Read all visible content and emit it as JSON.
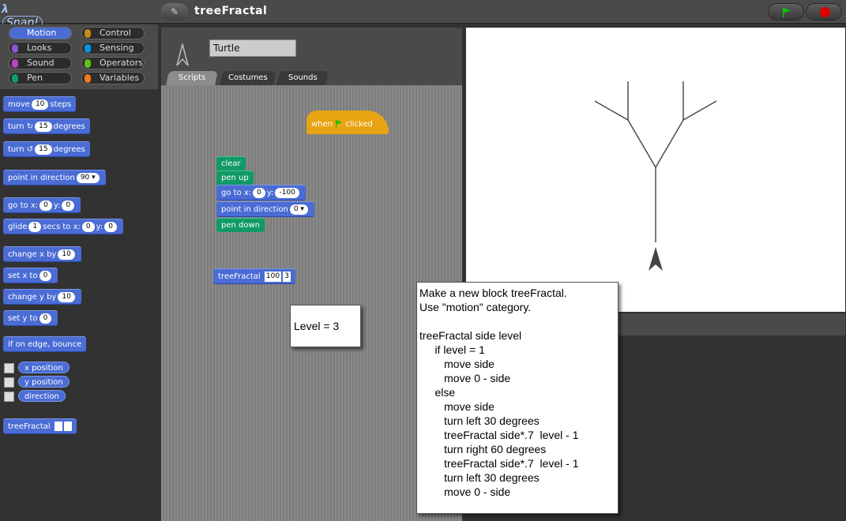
{
  "app": {
    "logo_lambda": "λ",
    "logo_text": "Snap!",
    "project_icon": "✎",
    "project_title": "treeFractal"
  },
  "colors": {
    "motion": "#4a6cd4",
    "control": "#e8a412",
    "pen": "#119a66",
    "stop": "#e00000",
    "go": "#00c000"
  },
  "categories": [
    {
      "label": "Motion",
      "color": "#4a6cd4",
      "selected": true
    },
    {
      "label": "Control",
      "color": "#c88a1a"
    },
    {
      "label": "Looks",
      "color": "#8a55d7"
    },
    {
      "label": "Sensing",
      "color": "#0494dc"
    },
    {
      "label": "Sound",
      "color": "#bb42c3"
    },
    {
      "label": "Operators",
      "color": "#62c213"
    },
    {
      "label": "Pen",
      "color": "#0e9a6c"
    },
    {
      "label": "Variables",
      "color": "#f3761d"
    }
  ],
  "palette": {
    "move": [
      "move",
      "10",
      "steps"
    ],
    "turn_cw": [
      "turn",
      "↻",
      "15",
      "degrees"
    ],
    "turn_ccw": [
      "turn",
      "↺",
      "15",
      "degrees"
    ],
    "point_dir": [
      "point in direction",
      "90 ▾"
    ],
    "goto": [
      "go to x:",
      "0",
      "y:",
      "0"
    ],
    "glide": [
      "glide",
      "1",
      "secs to x:",
      "0",
      "y:",
      "0"
    ],
    "change_x": [
      "change x by",
      "10"
    ],
    "set_x": [
      "set x to",
      "0"
    ],
    "change_y": [
      "change y by",
      "10"
    ],
    "set_y": [
      "set y to",
      "0"
    ],
    "bounce": "if on edge, bounce",
    "reporters": [
      "x position",
      "y position",
      "direction"
    ],
    "custom": "treeFractal"
  },
  "editor": {
    "sprite_name": "Turtle",
    "tabs": [
      "Scripts",
      "Costumes",
      "Sounds"
    ]
  },
  "script": {
    "hat": [
      "when",
      "clicked"
    ],
    "clear": "clear",
    "pen_up": "pen up",
    "goto": [
      "go to x:",
      "0",
      "y:",
      "-100"
    ],
    "point_dir": [
      "point in direction",
      "0 ▾"
    ],
    "pen_down": "pen down",
    "custom_call": [
      "treeFractal",
      "100",
      "3"
    ]
  },
  "notes": {
    "level": "Level = 3",
    "instructions": "Make a new block treeFractal.\nUse \"motion\" category.\n\ntreeFractal side level\n     if level = 1\n        move side\n        move 0 - side\n     else\n        move side\n        turn left 30 degrees\n        treeFractal side*.7  level - 1\n        turn right 60 degrees\n        treeFractal side*.7  level - 1\n        turn left 30 degrees\n        move 0 - side"
  }
}
